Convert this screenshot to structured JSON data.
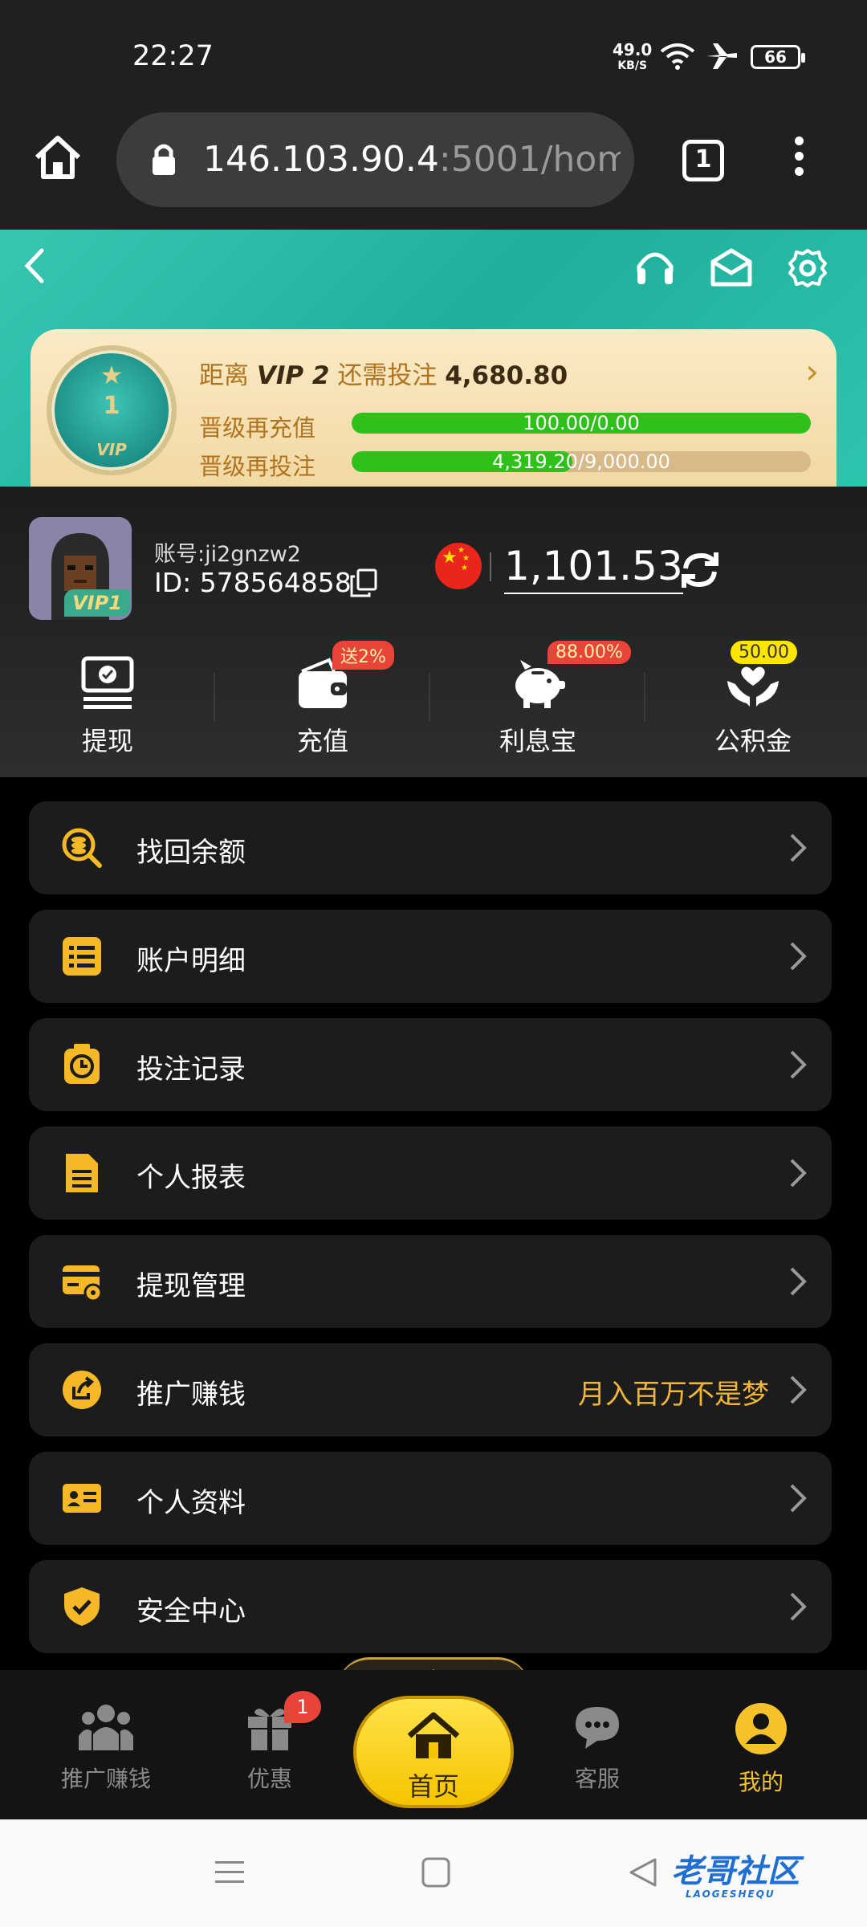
{
  "status_bar": {
    "time": "22:27",
    "net_speed": "49.0",
    "net_unit": "KB/S",
    "battery": "66",
    "icons": [
      "wifi-icon",
      "airplane-icon",
      "battery-icon"
    ]
  },
  "browser": {
    "url_host": "146.103.90.4",
    "url_rest": ":5001/hom",
    "tab_count": "1"
  },
  "header": {
    "icons": [
      "back-icon",
      "headset-icon",
      "mail-icon",
      "settings-icon"
    ]
  },
  "vip": {
    "current_level": "1",
    "badge_label": "VIP",
    "title_prefix": "距离",
    "next_level": "VIP 2",
    "title_mid": "还需投注",
    "remaining": "4,680.80",
    "rows": [
      {
        "label": "晋级再充值",
        "text": "100.00/0.00",
        "progress_pct": 100
      },
      {
        "label": "晋级再投注",
        "text": "4,319.20/9,000.00",
        "progress_pct": 48
      }
    ]
  },
  "user": {
    "account": "账号:ji2gnzw2",
    "id": "ID: 578564858",
    "vip_tag": "VIP1",
    "balance": "1,101.53"
  },
  "quick_actions": [
    {
      "label": "提现",
      "icon": "withdraw-icon",
      "badge": ""
    },
    {
      "label": "充值",
      "icon": "wallet-icon",
      "badge": "送2%"
    },
    {
      "label": "利息宝",
      "icon": "piggy-bank-icon",
      "badge": "88.00%"
    },
    {
      "label": "公积金",
      "icon": "hands-icon",
      "badge": "50.00"
    }
  ],
  "menu": [
    {
      "label": "找回余额",
      "icon": "search-coin-icon",
      "right": ""
    },
    {
      "label": "账户明细",
      "icon": "list-icon",
      "right": ""
    },
    {
      "label": "投注记录",
      "icon": "clock-icon",
      "right": ""
    },
    {
      "label": "个人报表",
      "icon": "document-icon",
      "right": ""
    },
    {
      "label": "提现管理",
      "icon": "card-gear-icon",
      "right": ""
    },
    {
      "label": "推广赚钱",
      "icon": "share-icon",
      "right": "月入百万不是梦"
    },
    {
      "label": "个人资料",
      "icon": "id-card-icon",
      "right": ""
    },
    {
      "label": "安全中心",
      "icon": "shield-icon",
      "right": ""
    }
  ],
  "bottom_nav": [
    {
      "label": "推广赚钱",
      "icon": "people-icon",
      "badge": ""
    },
    {
      "label": "优惠",
      "icon": "gift-icon",
      "badge": "1"
    },
    {
      "label": "首页",
      "icon": "home-icon",
      "badge": ""
    },
    {
      "label": "客服",
      "icon": "chat-icon",
      "badge": ""
    },
    {
      "label": "我的",
      "icon": "user-icon",
      "badge": ""
    }
  ],
  "watermark": {
    "text": "老哥社区",
    "sub": "LAOGESHEQU"
  },
  "colors": {
    "accent": "#f5c22b",
    "teal": "#2dc4ad",
    "progress": "#2dc11a",
    "badge_red": "#e9443a"
  }
}
